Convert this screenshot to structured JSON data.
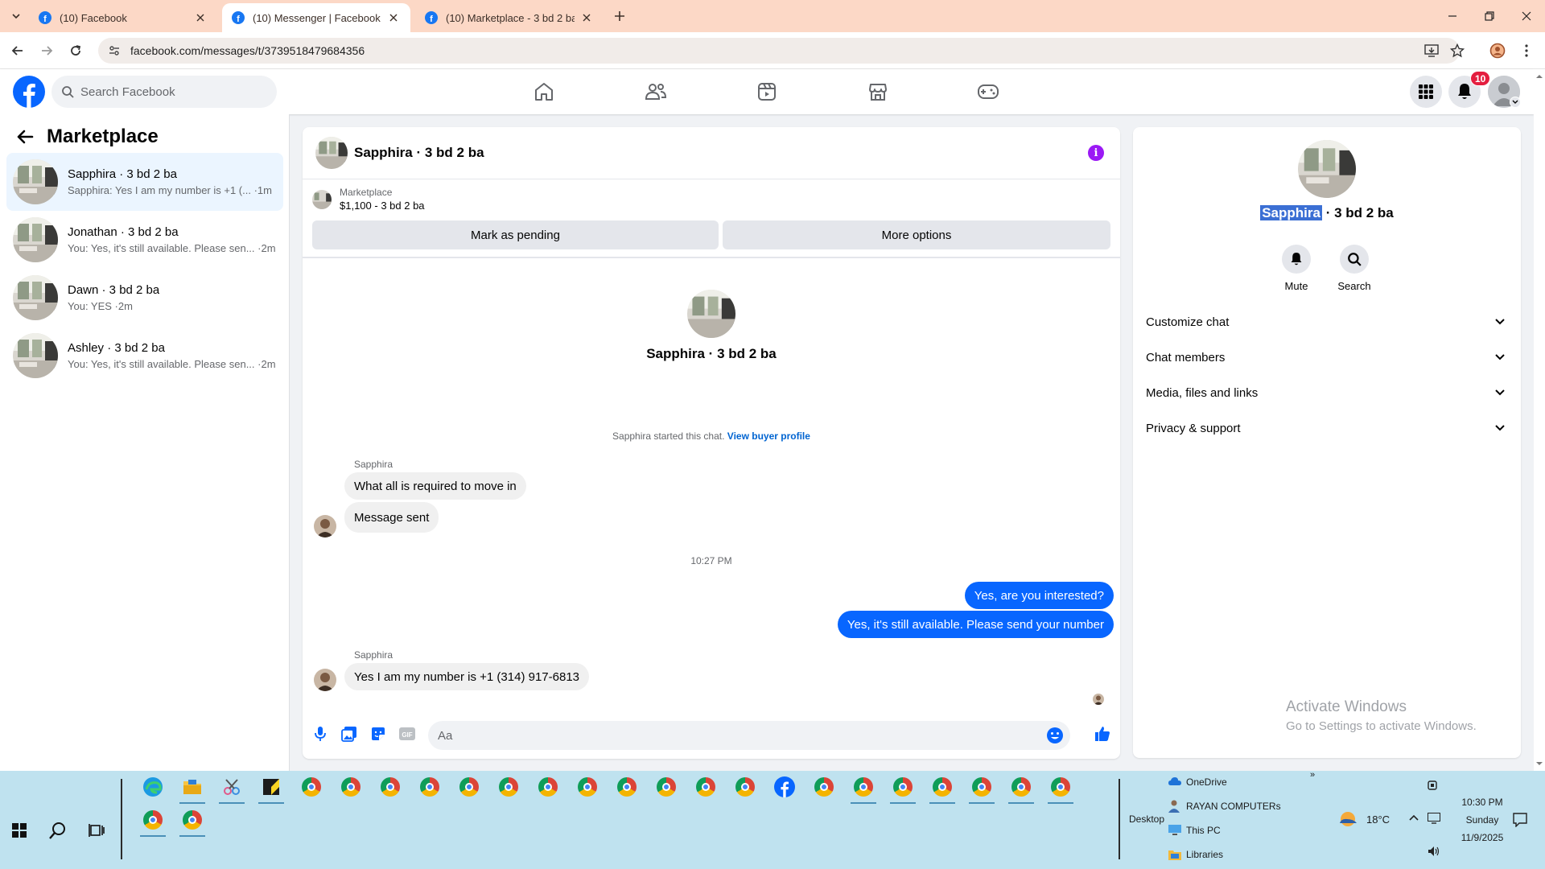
{
  "browser": {
    "tabs": [
      {
        "title": "(10) Facebook",
        "active": false
      },
      {
        "title": "(10) Messenger | Facebook",
        "active": true
      },
      {
        "title": "(10) Marketplace - 3 bd 2 ba | F",
        "active": false
      }
    ],
    "url": "facebook.com/messages/t/3739518479684356"
  },
  "fb": {
    "search_placeholder": "Search Facebook",
    "notif_count": "10"
  },
  "sidebar": {
    "title": "Marketplace",
    "conversations": [
      {
        "name": "Sapphira · 3 bd 2 ba",
        "preview": "Sapphira: Yes I am my number is +1 (... ·1m",
        "active": true
      },
      {
        "name": "Jonathan · 3 bd 2 ba",
        "preview": "You: Yes, it's still available. Please sen... ·2m",
        "active": false
      },
      {
        "name": "Dawn · 3 bd 2 ba",
        "preview": "You: YES ·2m",
        "active": false
      },
      {
        "name": "Ashley · 3 bd 2 ba",
        "preview": "You: Yes, it's still available. Please sen... ·2m",
        "active": false
      }
    ]
  },
  "chat": {
    "title": "Sapphira · 3 bd 2 ba",
    "marketplace_label": "Marketplace",
    "listing": "$1,100 - 3 bd 2 ba",
    "mark_pending": "Mark as pending",
    "more_options": "More options",
    "center_name": "Sapphira · 3 bd 2 ba",
    "started_text": "Sapphira started this chat.",
    "view_profile": "View buyer profile",
    "sender1": "Sapphira",
    "msg1": "What all is required to move in",
    "msg2": "Message sent",
    "timestamp": "10:27 PM",
    "out1": "Yes, are you interested?",
    "out2": "Yes, it's still available. Please send your number",
    "sender2": "Sapphira",
    "msg3": "Yes I am my number is +1 (314) 917-6813",
    "composer_placeholder": "Aa"
  },
  "rpanel": {
    "name_highlight": "Sapphira",
    "name_rest": " · 3 bd 2 ba",
    "mute": "Mute",
    "search": "Search",
    "rows": [
      "Customize chat",
      "Chat members",
      "Media, files and links",
      "Privacy & support"
    ]
  },
  "watermark": {
    "line1": "Activate Windows",
    "line2": "Go to Settings to activate Windows."
  },
  "taskbar": {
    "desktop": "Desktop",
    "folders": [
      "OneDrive",
      "RAYAN COMPUTERs",
      "This PC",
      "Libraries"
    ],
    "weather": "18°C",
    "time": "10:30 PM",
    "day": "Sunday",
    "date": "11/9/2025",
    "overflow": "»"
  }
}
